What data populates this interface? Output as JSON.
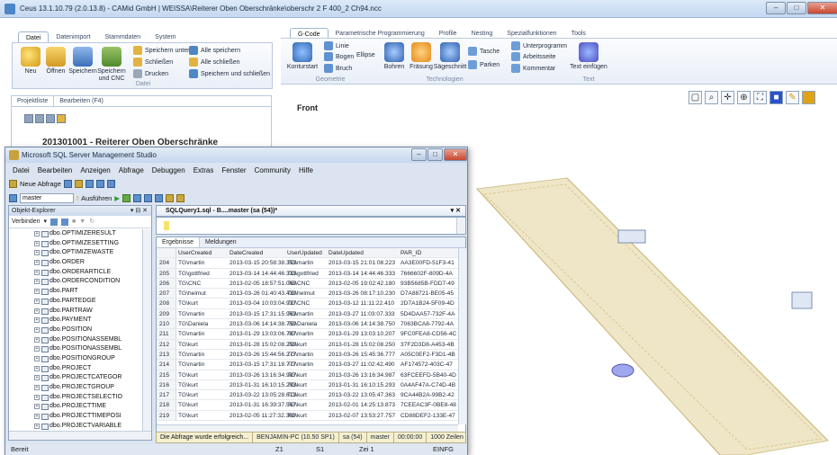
{
  "cam": {
    "title": "Ceus 13.1.10.79 (2.0.13.8) - CAMid GmbH | WEISSA\\Reiterer Oben Oberschränke\\oberschr 2 F 400_2 Ch94.ncc",
    "left_tabs": [
      "Datei",
      "Datenimport",
      "Stammdaten",
      "System"
    ],
    "left_group_label": "Datei",
    "file_buttons": [
      {
        "label": "Neu",
        "icon": "new-icon"
      },
      {
        "label": "Öffnen",
        "icon": "open-folder-icon"
      },
      {
        "label": "Speichern",
        "icon": "save-icon"
      },
      {
        "label": "Speichern und CNC",
        "icon": "save-cnc-icon"
      }
    ],
    "file_small_buttons": [
      {
        "label": "Speichern unter",
        "icon": "save-as-icon"
      },
      {
        "label": "Schließen",
        "icon": "close-file-icon"
      },
      {
        "label": "Drucken",
        "icon": "print-icon"
      },
      {
        "label": "Alle speichern",
        "icon": "save-all-icon"
      },
      {
        "label": "Alle schließen",
        "icon": "close-all-icon"
      },
      {
        "label": "Speichern und schließen",
        "icon": "save-close-icon"
      }
    ],
    "right_tabs": [
      "G-Code",
      "Parametrische Programmierung",
      "Profile",
      "Nesting",
      "Spezialfunktionen",
      "Tools"
    ],
    "geometrie": {
      "group_label": "Geometrie",
      "konturstart": "Konturstart",
      "small": [
        "Linie",
        "Bogen",
        "Ellipse",
        "Bruch"
      ]
    },
    "technologien": {
      "group_label": "Technologien",
      "buttons": [
        "Bohren",
        "Fräsung",
        "Sägeschnitt"
      ],
      "small": [
        "Tasche",
        "Parken"
      ]
    },
    "program": {
      "small": [
        "Unterprogramm",
        "Arbeitsseite",
        "Kommentar"
      ]
    },
    "text": {
      "group_label": "Text",
      "button": "Text einfügen"
    },
    "project": {
      "tabs": [
        "Projektliste",
        "Bearbeiten (F4)"
      ],
      "title": "201301001 - Reiterer Oben Oberschränke"
    },
    "view": {
      "front_label": "Front"
    }
  },
  "ssms": {
    "title": "Microsoft SQL Server Management Studio",
    "menu": [
      "Datei",
      "Bearbeiten",
      "Anzeigen",
      "Abfrage",
      "Debuggen",
      "Extras",
      "Fenster",
      "Community",
      "Hilfe"
    ],
    "new_query": "Neue Abfrage",
    "database": "master",
    "execute": "Ausführen",
    "object_explorer": {
      "title": "Objekt-Explorer",
      "connect": "Verbinden",
      "items": [
        "dbo.OPTIMIZERESULT",
        "dbo.OPTIMIZESETTING",
        "dbo.OPTIMIZEWASTE",
        "dbo.ORDER",
        "dbo.ORDERARTICLE",
        "dbo.ORDERCONDITION",
        "dbo.PART",
        "dbo.PARTEDGE",
        "dbo.PARTRAW",
        "dbo.PAYMENT",
        "dbo.POSITION",
        "dbo.POSITIONASSEMBL",
        "dbo.POSITIONASSEMBL",
        "dbo.POSITIONGROUP",
        "dbo.PROJECT",
        "dbo.PROJECTCATEGOR",
        "dbo.PROJECTGROUP",
        "dbo.PROJECTSELECTIO",
        "dbo.PROJECTTIME",
        "dbo.PROJECTTIMEPOSI",
        "dbo.PROJECTVARIABLE",
        "dbo.REPORT"
      ]
    },
    "query_tab": "SQLQuery1.sql - B....master (sa (54))*",
    "result_tabs": [
      "Ergebnisse",
      "Meldungen"
    ],
    "columns": [
      "UserCreated",
      "DateCreated",
      "UserUpdated",
      "DateUpdated",
      "PAR_ID"
    ],
    "rows": [
      [
        "204",
        "TG\\martin",
        "2013-03-15 20:58:38.353",
        "TG\\martin",
        "2013-03-15 21:01:08.223",
        "AA3E00FD-51F3-41"
      ],
      [
        "205",
        "TG\\gottfried",
        "2013-03-14 14:44:46.333",
        "TG\\gottfried",
        "2013-03-14 14:44:46.333",
        "7666602F-809D-4A"
      ],
      [
        "206",
        "TG\\CNC",
        "2013-02-05 18:57:51.060",
        "TG\\CNC",
        "2013-02-05 19:02:42.180",
        "93B5685B-FDD7-49"
      ],
      [
        "207",
        "TG\\helmut",
        "2013-03-26 01:40:43.430",
        "TG\\helmut",
        "2013-03-26 08:17:10.230",
        "D7A88721-BE05-45"
      ],
      [
        "208",
        "TG\\kurt",
        "2013-03-04 10:03:04.937",
        "TG\\CNC",
        "2013-03-12 11:11:22.410",
        "2D7A1B24-5F09-4D"
      ],
      [
        "209",
        "TG\\martin",
        "2013-03-15 17:31:15.963",
        "TG\\martin",
        "2013-03-27 11:03:07.333",
        "5D4DAA57-732F-4A"
      ],
      [
        "210",
        "TG\\Daniela",
        "2013-03-06 14:14:38.750",
        "TG\\Daniela",
        "2013-03-06 14:14:38.750",
        "7063BCA8-7792-4A"
      ],
      [
        "211",
        "TG\\martin",
        "2013-01-29 13:03:06.787",
        "TG\\martin",
        "2013-01-29 13:03:10.207",
        "9FC0FEA8-CD56-4C"
      ],
      [
        "212",
        "TG\\kurt",
        "2013-01-28 15:02:08.250",
        "TG\\kurt",
        "2013-01-28 15:02:08.250",
        "37F2D3D8-A453-4B"
      ],
      [
        "213",
        "TG\\martin",
        "2013-03-26 15:44:56.277",
        "TG\\martin",
        "2013-03-26 15:45:36.777",
        "A05C0EF2-F3D1-4B"
      ],
      [
        "214",
        "TG\\martin",
        "2013-03-15 17:31:18.777",
        "TG\\martin",
        "2013-03-27 11:02:42.490",
        "AF174572-403C-47"
      ],
      [
        "215",
        "TG\\kurt",
        "2013-03-26 13:16:34.987",
        "TG\\kurt",
        "2013-03-26 13:16:34.987",
        "63FCEEFD-5B40-4D"
      ],
      [
        "216",
        "TG\\kurt",
        "2013-01-31 16:10:15.293",
        "TG\\kurt",
        "2013-01-31 16:10:15.293",
        "0A4AF47A-C74D-4B"
      ],
      [
        "217",
        "TG\\kurt",
        "2013-03-22 13:05:28.613",
        "TG\\kurt",
        "2013-03-22 13:05:47.363",
        "9CA44B2A-99B2-42"
      ],
      [
        "218",
        "TG\\kurt",
        "2013-01-31 16:39:37.567",
        "TG\\kurt",
        "2013-02-01 14:25:13.873",
        "7CEEAC3F-0BE8-48"
      ],
      [
        "219",
        "TG\\kurt",
        "2013-02-05 11:27:32.360",
        "TG\\kurt",
        "2013-02-07 13:53:27.757",
        "CD88DEF2-133E-47"
      ]
    ],
    "query_status": "Die Abfrage wurde erfolgreich...",
    "server": "BENJAMIN-PC (10.50 SP1)",
    "login": "sa (54)",
    "db": "master",
    "time": "00:00:00",
    "row_count": "1000 Zeilen",
    "status": {
      "ready": "Bereit",
      "z": "Z1",
      "s": "S1",
      "zei": "Zei 1",
      "mode": "EINFG"
    }
  },
  "colors": {
    "accent": "#4a86c8",
    "panel_edge": "#8fa3bd",
    "board_fill": "#efe6c8",
    "board_edge": "#d2c48e"
  }
}
